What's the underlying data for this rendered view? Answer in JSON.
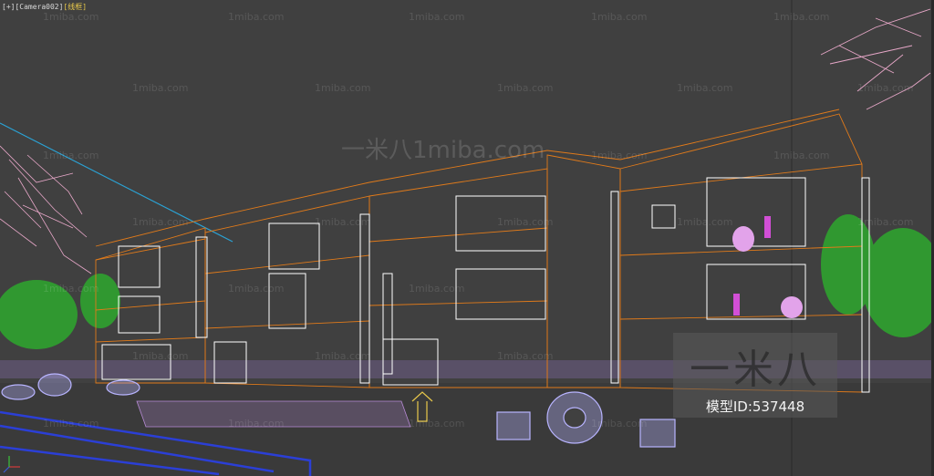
{
  "viewport": {
    "label_plus": "[+]",
    "label_camera": "[Camera002]",
    "label_mode": "[线框]"
  },
  "watermarks": {
    "small": "1miba.com",
    "big": "一米八1miba.com"
  },
  "badge": {
    "logo": "一米八",
    "model_id": "模型ID:537448"
  },
  "colors": {
    "background": "#404040",
    "building_wire": "#e07a1a",
    "windows": "#ffffff",
    "foliage_green": "#2ea82e",
    "foliage_pink": "#e7a7c8",
    "props_lavender": "#b8b4ff",
    "people_magenta": "#d24fd6",
    "ground_blue": "#2b3fd6",
    "camera_line": "#2aa3d6"
  }
}
